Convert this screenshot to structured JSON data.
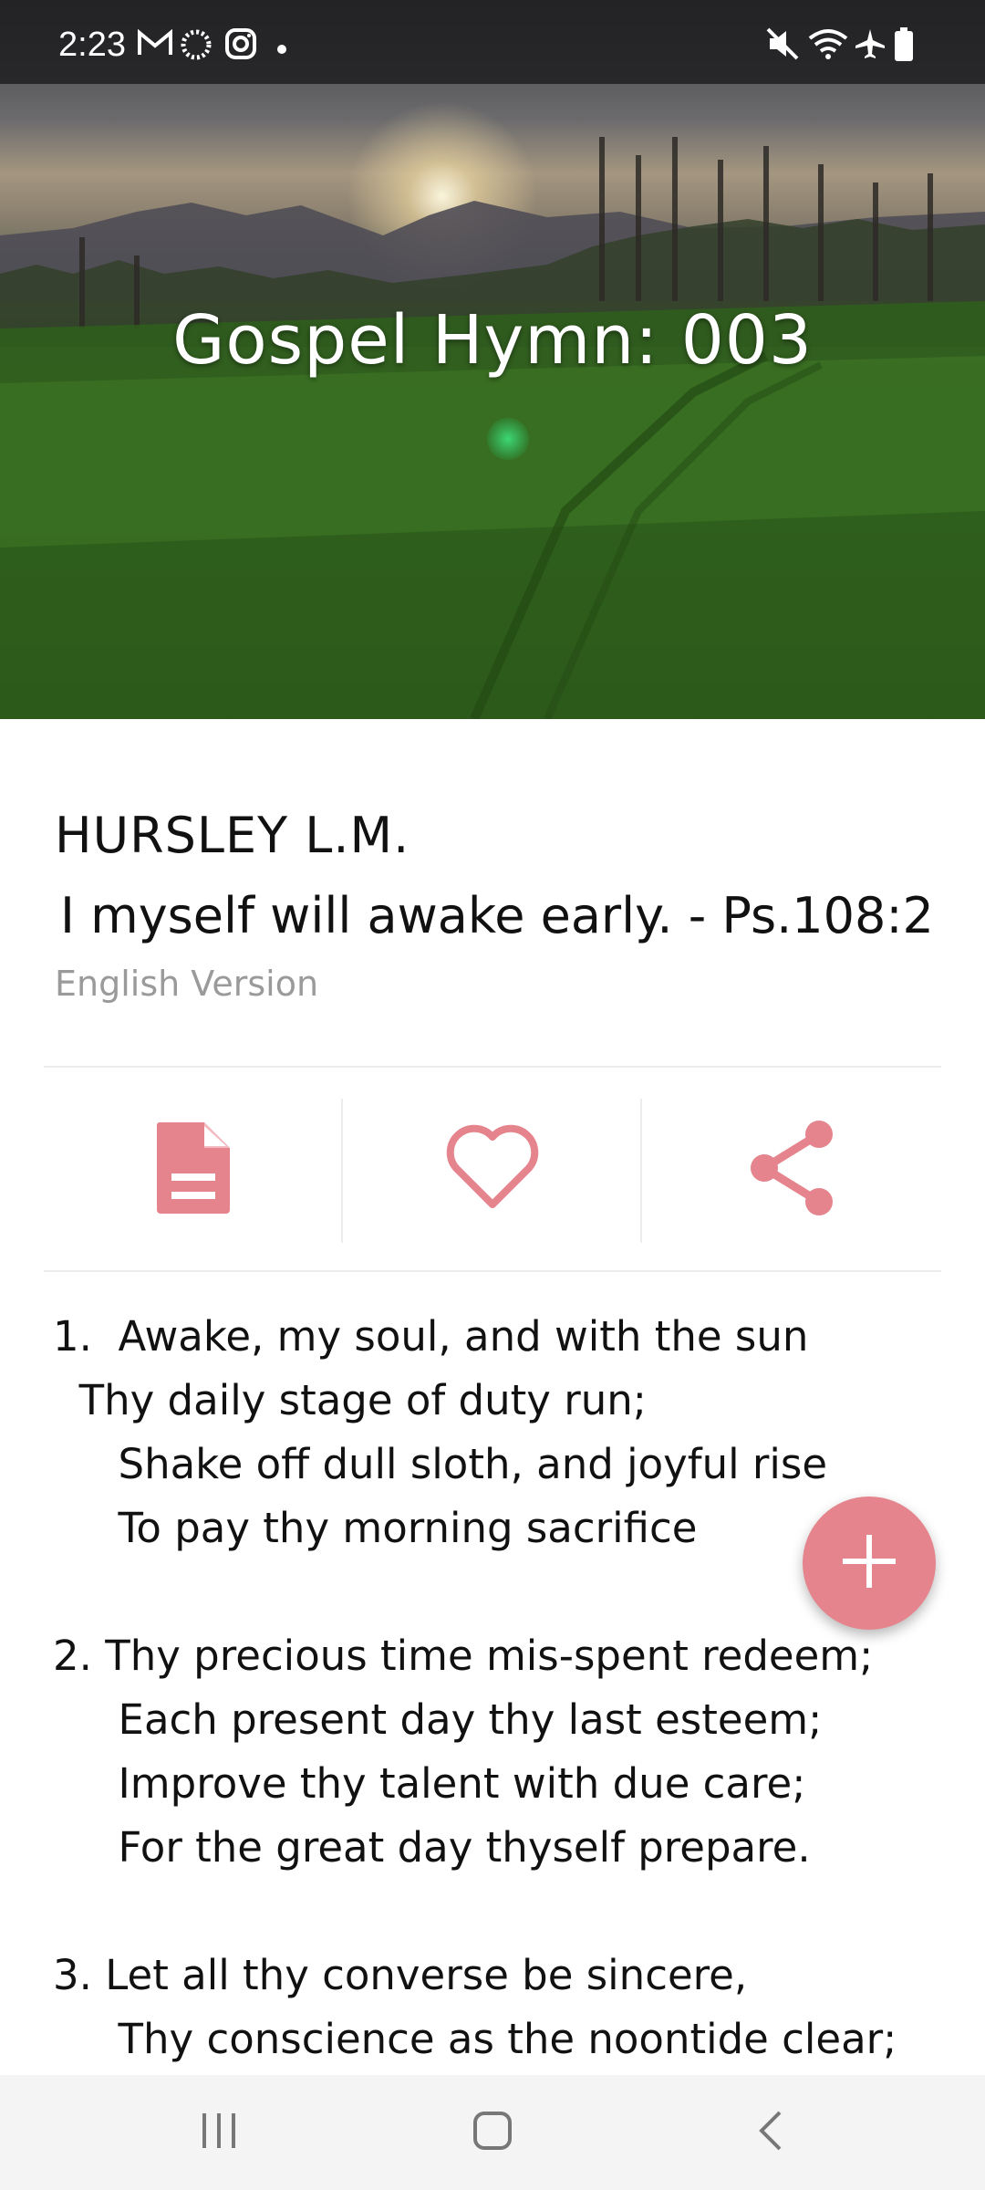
{
  "status_bar": {
    "time": "2:23",
    "icons": [
      "gmail-icon",
      "sync-icon",
      "instagram-icon",
      "notification-dot-icon",
      "mute-icon",
      "wifi-icon",
      "airplane-icon",
      "battery-icon"
    ]
  },
  "header": {
    "title": "Gospel Hymn: 003"
  },
  "hymn": {
    "tune": "HURSLEY L.M.",
    "scripture": " I myself will awake early. - Ps.108:2",
    "version": "English Version"
  },
  "actions": [
    {
      "name": "lyrics",
      "icon": "document-icon"
    },
    {
      "name": "favorite",
      "icon": "heart-icon"
    },
    {
      "name": "share",
      "icon": "share-icon"
    }
  ],
  "lyrics": {
    "stanzas": [
      [
        "1.  Awake, my soul, and with the sun",
        "  Thy daily stage of duty run;",
        "     Shake off dull sloth, and joyful rise",
        "     To pay thy morning sacrifice"
      ],
      [
        "2. Thy precious time mis-spent redeem;",
        "     Each present day thy last esteem;",
        "     Improve thy talent with due care;",
        "     For the great day thyself prepare."
      ],
      [
        "3. Let all thy converse be sincere,",
        "     Thy conscience as the noontide clear;"
      ]
    ]
  },
  "fab": {
    "icon": "plus-icon"
  },
  "nav": {
    "icons": [
      "recent-apps-icon",
      "home-icon",
      "back-icon"
    ]
  },
  "colors": {
    "accent": "#e5848d",
    "text": "#111111",
    "muted": "#9a9a9a"
  }
}
